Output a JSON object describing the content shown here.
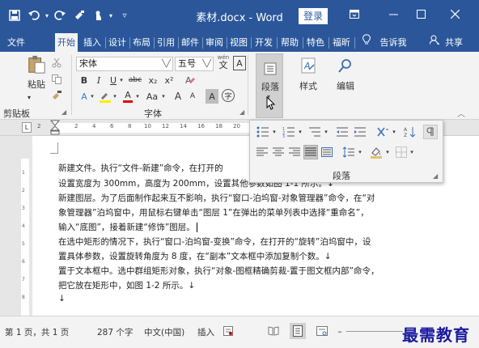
{
  "titlebar": {
    "doc_title": "素材.docx  -  Word",
    "login_label": "登录",
    "icons": [
      "save-icon",
      "undo-icon",
      "redo-icon",
      "format-painter-icon",
      "touch-mode-icon",
      "customize-qa-icon",
      "ribbon-display-icon",
      "minimize-icon",
      "maximize-icon",
      "close-icon"
    ]
  },
  "menu": {
    "tabs": [
      "文件",
      "开始",
      "插入",
      "设计",
      "布局",
      "引用",
      "邮件",
      "审阅",
      "视图",
      "开发",
      "帮助",
      "特色",
      "福昕",
      "告诉我",
      "共享"
    ],
    "active_tab": "开始"
  },
  "ribbon": {
    "clipboard": {
      "paste_label": "粘贴",
      "group_label": "剪贴板"
    },
    "font": {
      "font_name": "宋体",
      "font_size": "五号",
      "wen_label": "wén",
      "wen_char": "文",
      "a_char": "A",
      "bold": "B",
      "italic": "I",
      "underline": "U",
      "strike": "abc",
      "subscript": "x₂",
      "superscript": "x²",
      "text_effects": "A",
      "highlight": "ab",
      "font_color": "A",
      "change_case": "Aa",
      "grow": "A",
      "shrink": "A",
      "char_shading": "A",
      "enclose": "字",
      "group_label": "字体"
    },
    "paragraph": {
      "label": "段落"
    },
    "styles": {
      "label": "样式"
    },
    "editing": {
      "label": "编辑"
    }
  },
  "ruler": {
    "l_mark": "L",
    "numbers": [
      "2",
      "2",
      "4",
      "6",
      "8",
      "10",
      "12",
      "14",
      "16",
      "18",
      "20"
    ]
  },
  "vruler": {
    "numbers": [
      "1",
      "2",
      "3",
      "4",
      "5",
      "6",
      "7",
      "8",
      "9",
      "10"
    ]
  },
  "paragraph_panel": {
    "group_label": "段落"
  },
  "document": {
    "lines": [
      "新建文件。执行“文件-新建”命令，在打开的",
      "设置宽度为 300mm，高度为 200mm，设置其他参数如图 1-1 所示。↓",
      "新建图层。为了后面制作起来互不影响，执行“窗口-泊坞窗-对象管理器”命令，在“对",
      "象管理器”泊坞窗中，用鼠标右键单击“图层 1”在弹出的菜单列表中选择“重命名”，",
      "输入“底图”，接着新建“修饰”图层。",
      "在选中矩形的情况下，执行“窗口-泊坞窗-变换”命令，在打开的“旋转”泊坞窗中，设",
      "置具体参数，设置旋转角度为 8 度，在“副本”文本框中添加复制个数。↓",
      "置于文本框中。选中群组矩形对象，执行“对象-图框精确剪裁-置于图文框内部”命令，",
      "把它放在矩形中，如图 1-2 所示。↓",
      "↓"
    ]
  },
  "statusbar": {
    "page": "第 1 页，共 1 页",
    "words": "287 个字",
    "language": "中文(中国)",
    "mode": "插入"
  },
  "watermark": "最需教育",
  "colors": {
    "accent": "#2b579a",
    "ribbon_bg": "#f3f3f3",
    "watermark": "#1a1aa0"
  }
}
